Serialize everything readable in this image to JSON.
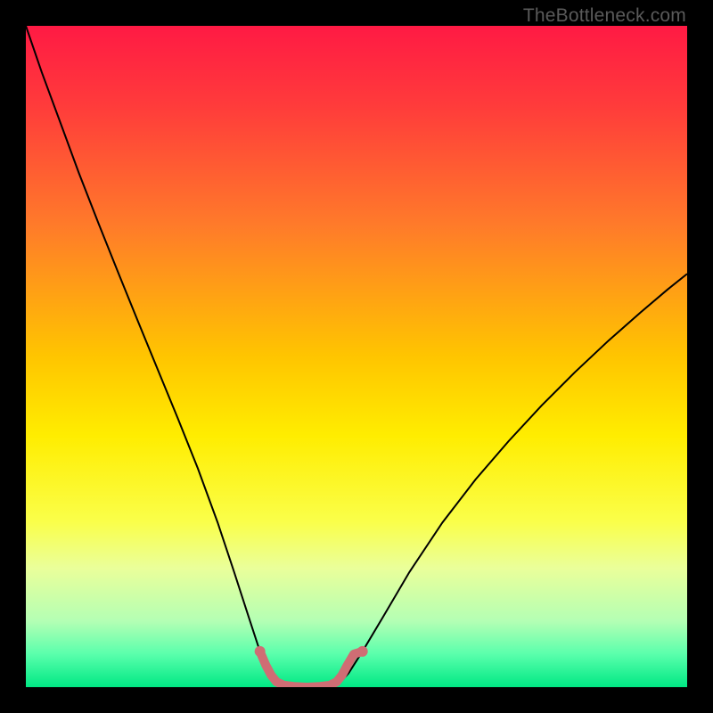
{
  "watermark": "TheBottleneck.com",
  "chart_data": {
    "type": "line",
    "title": "",
    "xlabel": "",
    "ylabel": "",
    "xlim": [
      0,
      100
    ],
    "ylim": [
      0,
      100
    ],
    "background_gradient": {
      "stops": [
        {
          "offset": 0.0,
          "color": "#ff1a44"
        },
        {
          "offset": 0.12,
          "color": "#ff3b3b"
        },
        {
          "offset": 0.3,
          "color": "#ff7a2a"
        },
        {
          "offset": 0.5,
          "color": "#ffc500"
        },
        {
          "offset": 0.62,
          "color": "#ffed00"
        },
        {
          "offset": 0.75,
          "color": "#faff4a"
        },
        {
          "offset": 0.82,
          "color": "#eaff9a"
        },
        {
          "offset": 0.9,
          "color": "#b4ffb4"
        },
        {
          "offset": 0.95,
          "color": "#5affac"
        },
        {
          "offset": 1.0,
          "color": "#00e884"
        }
      ]
    },
    "series": [
      {
        "name": "left-curve",
        "x": [
          0.0,
          2.4,
          5.5,
          8.0,
          11.0,
          14.0,
          17.0,
          20.0,
          23.0,
          26.0,
          29.0,
          31.5,
          33.7,
          35.4,
          36.8,
          37.9,
          38.7
        ],
        "y": [
          100.0,
          93.0,
          84.6,
          77.8,
          70.1,
          62.6,
          55.2,
          47.9,
          40.6,
          33.1,
          24.9,
          17.4,
          10.6,
          5.4,
          2.1,
          0.6,
          0.2
        ],
        "stroke": "#000000",
        "width": 2
      },
      {
        "name": "right-curve",
        "x": [
          46.5,
          47.4,
          48.8,
          50.9,
          54.0,
          58.0,
          63.0,
          68.0,
          73.0,
          78.0,
          83.0,
          88.0,
          93.0,
          97.0,
          100.0
        ],
        "y": [
          0.2,
          0.6,
          2.1,
          5.4,
          10.6,
          17.4,
          24.9,
          31.4,
          37.2,
          42.6,
          47.6,
          52.3,
          56.7,
          60.1,
          62.5
        ],
        "stroke": "#000000",
        "width": 2
      },
      {
        "name": "highlight-band",
        "x": [
          35.4,
          36.3,
          37.1,
          37.9,
          39.0,
          40.5,
          42.5,
          44.5,
          46.0,
          47.0,
          47.8,
          48.6,
          49.6,
          50.9
        ],
        "y": [
          5.4,
          3.3,
          1.8,
          0.8,
          0.3,
          0.1,
          0.0,
          0.1,
          0.3,
          0.8,
          1.8,
          3.3,
          5.0,
          5.4
        ],
        "stroke": "#cf6d74",
        "width": 10,
        "linecap": "round"
      }
    ]
  }
}
